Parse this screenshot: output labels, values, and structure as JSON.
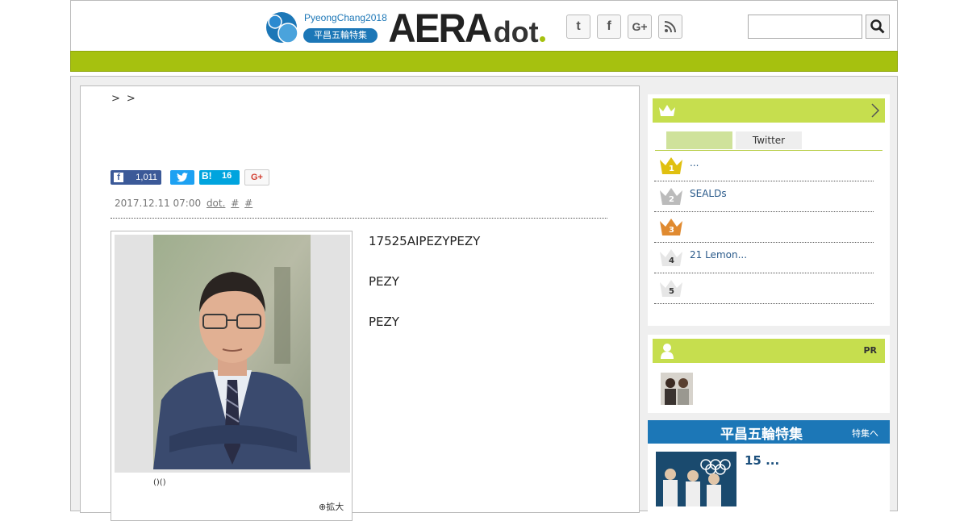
{
  "header": {
    "olympic_brand": "PyeongChang2018",
    "olympic_badge": "平昌五輪特集",
    "logo_main": "AERA",
    "logo_sub": "dot",
    "social": [
      {
        "icon": "twitter-icon",
        "glyph": "t"
      },
      {
        "icon": "facebook-icon",
        "glyph": "f"
      },
      {
        "icon": "google-plus-icon",
        "glyph": "G+"
      },
      {
        "icon": "rss-icon",
        "glyph": ""
      }
    ],
    "search_placeholder": ""
  },
  "breadcrumb": {
    "separators": ">>"
  },
  "share": {
    "facebook_count": "1,011",
    "hatena_label": "B!",
    "hatena_count": "16",
    "gplus_label": "G+"
  },
  "meta": {
    "date": "2017.12.11 07:00",
    "source": "dot.",
    "tag1": "#",
    "tag2": "#"
  },
  "photo": {
    "caption": "()()",
    "enlarge": "拡大"
  },
  "article": {
    "paragraphs": [
      "17525AIPEZYPEZY",
      "PEZY",
      "PEZY"
    ]
  },
  "sidebar": {
    "ranking": {
      "tabs": [
        "",
        "Twitter"
      ],
      "items": [
        {
          "rank": "1",
          "text": "...",
          "color": "#e0c010"
        },
        {
          "rank": "2",
          "text": "SEALDs",
          "color": "#bbbbbb"
        },
        {
          "rank": "3",
          "text": "",
          "color": "#e08a30"
        },
        {
          "rank": "4",
          "text": "21 Lemon...",
          "color": "#dddddd"
        },
        {
          "rank": "5",
          "text": "",
          "color": "#dddddd"
        }
      ]
    },
    "pr": {
      "label": "PR"
    },
    "olympic": {
      "title": "平昌五輪特集",
      "link": "特集へ",
      "headline": "15 ..."
    }
  },
  "colors": {
    "accent_green": "#a6c10f",
    "side_green": "#c6de4e",
    "brand_blue": "#1c77b7"
  }
}
